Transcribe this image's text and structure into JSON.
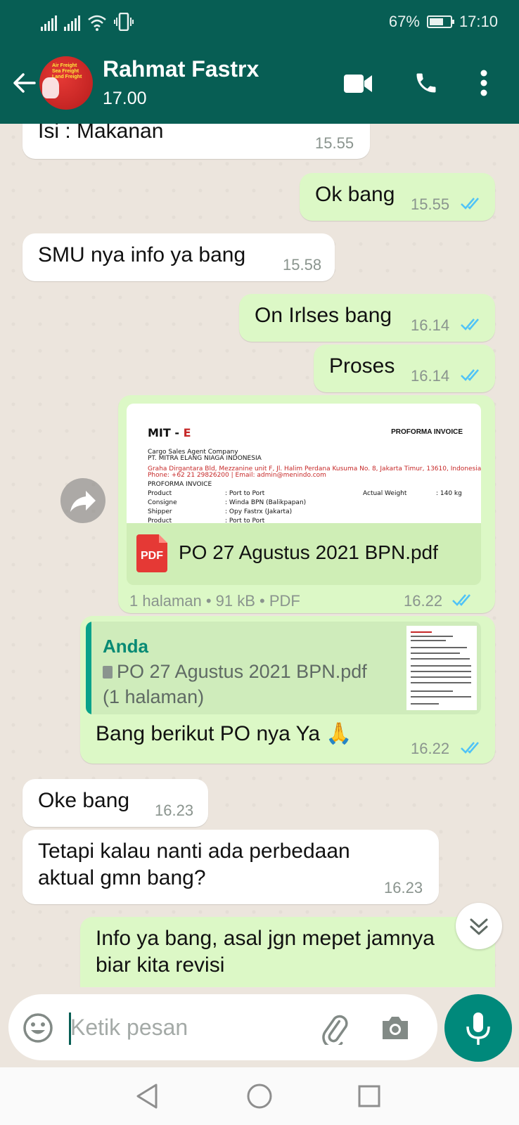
{
  "status_bar": {
    "battery_percent": "67%",
    "battery_level": 0.67,
    "time": "17:10",
    "icons": [
      "signal-icon",
      "signal-icon",
      "wifi-icon",
      "vibrate-icon",
      "battery-icon"
    ]
  },
  "header": {
    "contact_name": "Rahmat Fastrx",
    "last_seen": "17.00",
    "avatar_text": [
      "Air Freight",
      "Sea Freight",
      "Land Freight"
    ],
    "icons": [
      "back-arrow-icon",
      "video-call-icon",
      "phone-call-icon",
      "more-options-icon"
    ]
  },
  "messages": [
    {
      "direction": "in",
      "text": "Isi : Makanan",
      "time": "15.55"
    },
    {
      "direction": "out",
      "text": "Ok bang",
      "time": "15.55",
      "status": "read"
    },
    {
      "direction": "in",
      "text": "SMU nya info ya bang",
      "time": "15.58"
    },
    {
      "direction": "out",
      "text": "On Irlses bang",
      "time": "16.14",
      "status": "read"
    },
    {
      "direction": "out",
      "text": "Proses",
      "time": "16.14",
      "status": "read"
    },
    {
      "direction": "out",
      "type": "document",
      "preview": {
        "brand": "MIT - ",
        "brand_accent": "E",
        "title": "PROFORMA INVOICE",
        "company_line": "Cargo Sales Agent Company",
        "company": "PT. MITRA ELANG NIAGA INDONESIA",
        "address": "Graha Dirgantara Bld, Mezzanine unit F, Jl. Halim Perdana Kusuma No. 8, Jakarta Timur, 13610, Indonesia",
        "contact": "Phone: +62 21 29826200 | Email: admin@menindo.com",
        "subtitle": "PROFORMA INVOICE",
        "rows": [
          {
            "label": "Product",
            "value": ": Port to Port"
          },
          {
            "label": "Consigne",
            "value": ": Winda BPN (Balikpapan)"
          },
          {
            "label": "Shipper",
            "value": ": Opy Fastrx (Jakarta)"
          },
          {
            "label": "Product",
            "value": ": Port to Port"
          }
        ],
        "weight_label": "Actual Weight",
        "weight_value": ": 140 kg"
      },
      "file_icon": "PDF",
      "file_name": "PO 27 Agustus 2021 BPN.pdf",
      "meta": "1 halaman • 91 kB • PDF",
      "time": "16.22",
      "status": "read"
    },
    {
      "direction": "out",
      "type": "reply",
      "quote": {
        "author": "Anda",
        "file": "PO 27 Agustus 2021 BPN.pdf",
        "pages": "(1 halaman)"
      },
      "text": "Bang berikut PO nya Ya 🙏",
      "time": "16.22",
      "status": "read"
    },
    {
      "direction": "in",
      "text": "Oke bang",
      "time": "16.23"
    },
    {
      "direction": "in",
      "text_lines": [
        "Tetapi kalau nanti ada perbedaan",
        "aktual gmn bang?"
      ],
      "time": "16.23"
    },
    {
      "direction": "out",
      "text_lines": [
        "Info ya bang, asal jgn mepet jamnya",
        "biar kita revisi"
      ]
    }
  ],
  "composer": {
    "placeholder": "Ketik pesan",
    "icons": [
      "emoji-icon",
      "attachment-icon",
      "camera-icon",
      "microphone-icon"
    ]
  },
  "nav_bar": {
    "icons": [
      "back-triangle-icon",
      "home-circle-icon",
      "recents-square-icon"
    ]
  },
  "colors": {
    "header": "#075e54",
    "outgoing_bubble": "#dcf8c6",
    "incoming_bubble": "#ffffff",
    "read_tick": "#4fc3f7",
    "accent": "#00897b"
  }
}
